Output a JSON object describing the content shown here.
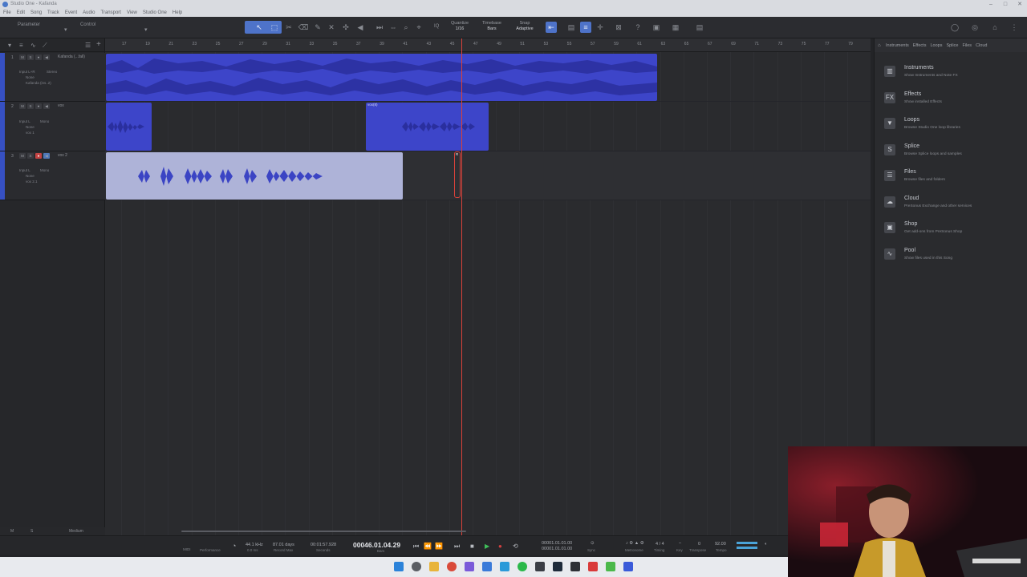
{
  "window": {
    "title": "Studio One - Kafanda"
  },
  "menu": [
    "File",
    "Edit",
    "Song",
    "Track",
    "Event",
    "Audio",
    "Transport",
    "View",
    "Studio One",
    "Help"
  ],
  "toolbar": {
    "parameter_label": "Parameter",
    "control_label": "Control",
    "quantize_label": "Quantize",
    "quantize_value": "1/16",
    "timebase_label": "Timebase",
    "timebase_value": "Bars",
    "snap_label": "Snap",
    "snap_value": "Adaptive",
    "iq_label": "IQ"
  },
  "ruler": {
    "bars": [
      "17",
      "19",
      "21",
      "23",
      "25",
      "27",
      "29",
      "31",
      "33",
      "35",
      "37",
      "39",
      "41",
      "43",
      "45",
      "47",
      "49",
      "51",
      "53",
      "55",
      "57",
      "59",
      "61",
      "63",
      "65",
      "67",
      "69",
      "71",
      "73",
      "75",
      "77",
      "79"
    ]
  },
  "tracks": [
    {
      "num": "1",
      "name": "Kafanda (...fall)",
      "input": "Input L+R",
      "input_mode": "Stereo",
      "out": "None",
      "sub": "Kafanda (ins..2)",
      "rec_armed": false
    },
    {
      "num": "2",
      "name": "vox",
      "input": "Input L",
      "input_mode": "Mono",
      "out": "None",
      "sub": "vox 1",
      "rec_armed": false
    },
    {
      "num": "3",
      "name": "vox 2",
      "input": "Input L",
      "input_mode": "Mono",
      "out": "None",
      "sub": "vox 2.1",
      "rec_armed": true
    }
  ],
  "clips": {
    "track2_second": "vox(8)",
    "cursor_marker": "R"
  },
  "browser": {
    "tabs": [
      "Instruments",
      "Effects",
      "Loops",
      "Splice",
      "Files",
      "Cloud"
    ],
    "items": [
      {
        "title": "Instruments",
        "desc": "Show Instruments and Note FX",
        "icon": "piano-icon",
        "glyph": "▥"
      },
      {
        "title": "Effects",
        "desc": "Show installed Effects",
        "icon": "fx-icon",
        "glyph": "FX"
      },
      {
        "title": "Loops",
        "desc": "Browse Studio One loop libraries",
        "icon": "loop-icon",
        "glyph": "▼"
      },
      {
        "title": "Splice",
        "desc": "Browse Splice loops and samples",
        "icon": "splice-icon",
        "glyph": "S"
      },
      {
        "title": "Files",
        "desc": "Browse files and folders",
        "icon": "files-icon",
        "glyph": "☰"
      },
      {
        "title": "Cloud",
        "desc": "PreSonus Exchange and other services",
        "icon": "cloud-icon",
        "glyph": "☁"
      },
      {
        "title": "Shop",
        "desc": "Get add-ons from PreSonus Shop",
        "icon": "shop-icon",
        "glyph": "▣"
      },
      {
        "title": "Pool",
        "desc": "Show files used in this Song",
        "icon": "pool-icon",
        "glyph": "∿"
      }
    ]
  },
  "bottom_left": {
    "m": "M",
    "s": "S",
    "size": "Medium"
  },
  "transport": {
    "midi": "MIDI",
    "performance": "Performance",
    "sample_rate": "44.1 kHz",
    "latency": "0.0 ms",
    "record_max_value": "87.01 days",
    "record_max_label": "Record Max",
    "seconds_value": "00:01:57.928",
    "seconds_label": "Seconds",
    "position": "00046.01.04.29",
    "position_label": "Bars",
    "loop_start": "00001.01.01.00",
    "loop_end": "00001.01.01.00",
    "sync": "Sync",
    "metronome": "Metronome",
    "timing": "Timing",
    "signature": "4 / 4",
    "key": "Key",
    "transpose_value": "0",
    "transpose": "Transpose",
    "tempo_value": "92.00",
    "tempo": "Tempo"
  },
  "colors": {
    "accent": "#4e73c9",
    "clip": "#3d45c9",
    "clip_selected": "#aeb3d8",
    "playhead": "#d9423a",
    "record": "#d24040",
    "play": "#3fbf5a"
  }
}
